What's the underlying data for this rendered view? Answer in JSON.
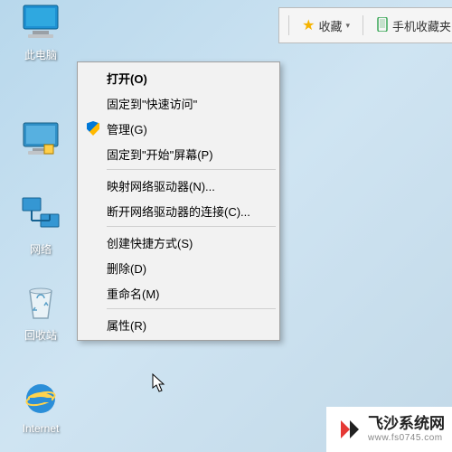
{
  "desktop_icons": {
    "this_pc": "此电脑",
    "network": "网络",
    "recycle_bin": "回收站",
    "internet": "Internet"
  },
  "toolbar": {
    "favorites": "收藏",
    "mobile_fav": "手机收藏夹"
  },
  "context_menu": {
    "open": "打开(O)",
    "pin_quick_access": "固定到\"快速访问\"",
    "manage": "管理(G)",
    "pin_start": "固定到\"开始\"屏幕(P)",
    "map_network_drive": "映射网络驱动器(N)...",
    "disconnect_network_drive": "断开网络驱动器的连接(C)...",
    "create_shortcut": "创建快捷方式(S)",
    "delete": "删除(D)",
    "rename": "重命名(M)",
    "properties": "属性(R)"
  },
  "watermark": {
    "brand": "飞沙系统网",
    "url": "www.fs0745.com"
  }
}
